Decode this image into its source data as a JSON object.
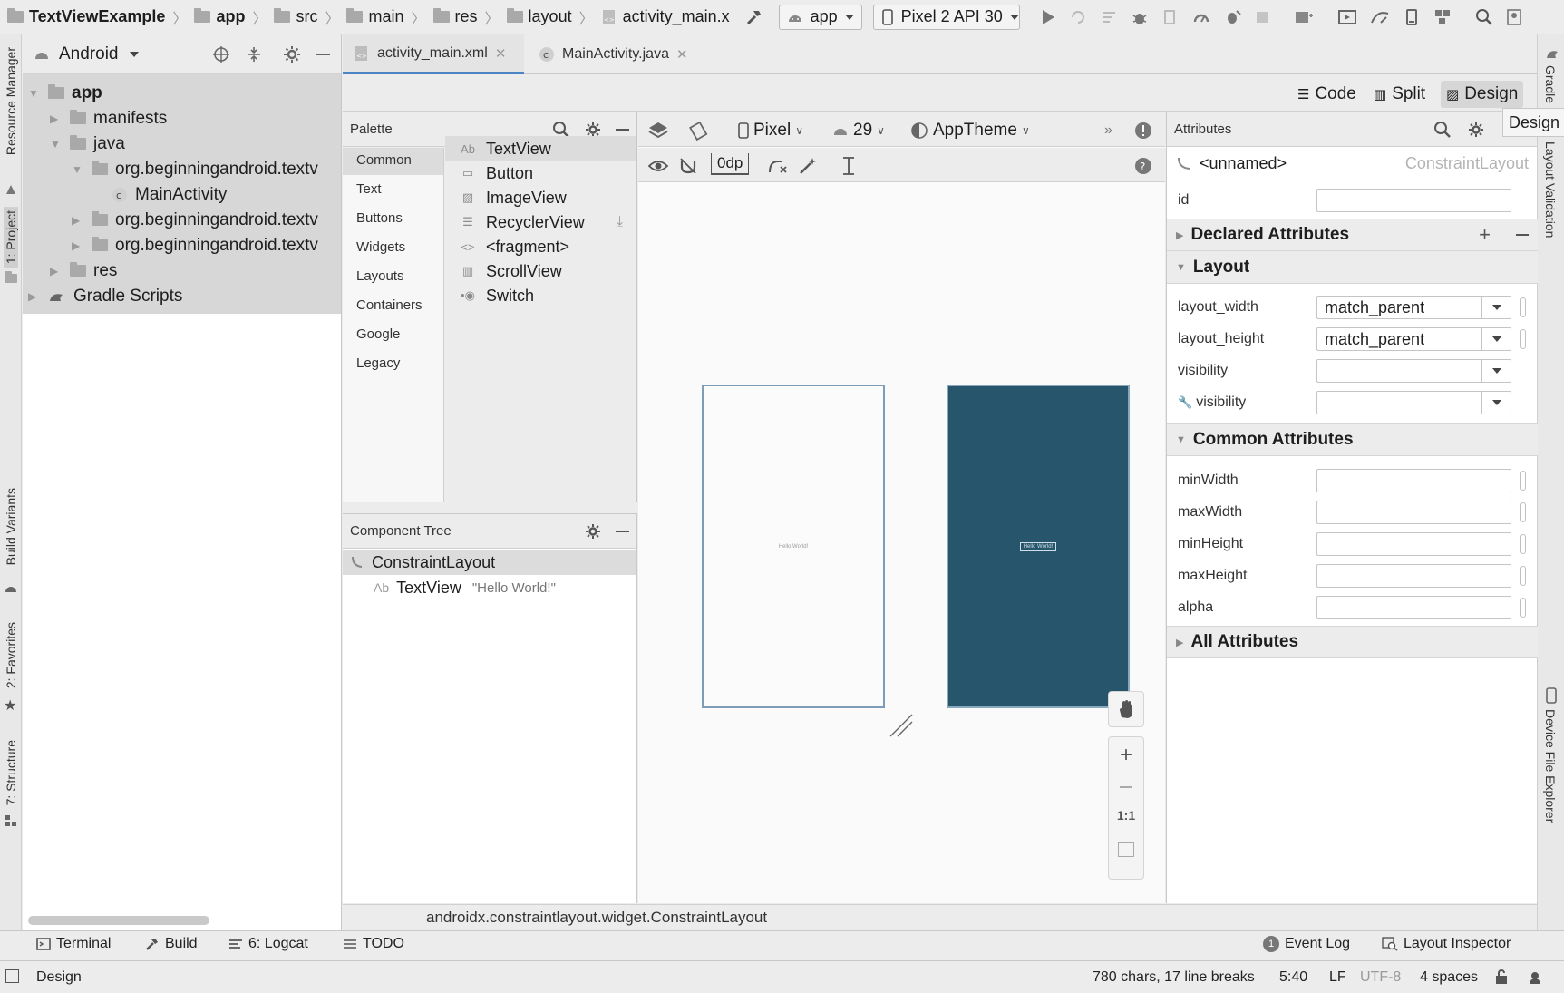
{
  "navbar": {
    "crumbs": [
      "TextViewExample",
      "app",
      "src",
      "main",
      "res",
      "layout",
      "activity_main.x"
    ],
    "run_config": "app",
    "device": "Pixel 2 API 30"
  },
  "left_strip": {
    "resource_manager": "Resource Manager",
    "project": "1: Project",
    "build_variants": "Build Variants",
    "favorites": "2: Favorites",
    "structure": "7: Structure"
  },
  "right_strip": {
    "gradle": "Gradle",
    "layout_validation": "Layout Validation",
    "device_file_explorer": "Device File Explorer"
  },
  "project": {
    "view_selector": "Android",
    "tree": [
      {
        "label": "app",
        "bold": true
      },
      {
        "label": "manifests"
      },
      {
        "label": "java"
      },
      {
        "label": "org.beginningandroid.textv"
      },
      {
        "label": "MainActivity"
      },
      {
        "label": "org.beginningandroid.textv"
      },
      {
        "label": "org.beginningandroid.textv"
      },
      {
        "label": "res"
      },
      {
        "label": "Gradle Scripts"
      }
    ]
  },
  "editor_tabs": [
    {
      "label": "activity_main.xml",
      "active": true
    },
    {
      "label": "MainActivity.java",
      "active": false
    }
  ],
  "modes": {
    "code": "Code",
    "split": "Split",
    "design": "Design",
    "tooltip": "Design"
  },
  "palette": {
    "title": "Palette",
    "categories": [
      "Common",
      "Text",
      "Buttons",
      "Widgets",
      "Layouts",
      "Containers",
      "Google",
      "Legacy"
    ],
    "selected_category": "Common",
    "items": [
      {
        "glyph": "Ab",
        "label": "TextView"
      },
      {
        "glyph": "▭",
        "label": "Button"
      },
      {
        "glyph": "▨",
        "label": "ImageView"
      },
      {
        "glyph": "☰",
        "label": "RecyclerView"
      },
      {
        "glyph": "<>",
        "label": "<fragment>"
      },
      {
        "glyph": "▥",
        "label": "ScrollView"
      },
      {
        "glyph": "•◉",
        "label": "Switch"
      }
    ]
  },
  "component_tree": {
    "title": "Component Tree",
    "root": "ConstraintLayout",
    "child_label": "TextView",
    "child_glyph": "Ab",
    "child_text": "\"Hello World!\""
  },
  "surface": {
    "device": "Pixel",
    "api": "29",
    "theme": "AppTheme",
    "margin": "0dp",
    "preview_text": "Hello World!",
    "blueprint_color": "#27556b",
    "zoom_label": "1:1"
  },
  "attributes": {
    "title": "Attributes",
    "component_name": "<unnamed>",
    "component_type": "ConstraintLayout",
    "id_label": "id",
    "id_value": "",
    "declared_section": "Declared Attributes",
    "layout_section": "Layout",
    "layout_rows": [
      {
        "label": "layout_width",
        "value": "match_parent"
      },
      {
        "label": "layout_height",
        "value": "match_parent"
      },
      {
        "label": "visibility",
        "value": ""
      },
      {
        "label": "visibility",
        "value": ""
      }
    ],
    "common_section": "Common Attributes",
    "common_rows": [
      {
        "label": "minWidth",
        "value": ""
      },
      {
        "label": "maxWidth",
        "value": ""
      },
      {
        "label": "minHeight",
        "value": ""
      },
      {
        "label": "maxHeight",
        "value": ""
      },
      {
        "label": "alpha",
        "value": ""
      }
    ],
    "all_section": "All Attributes"
  },
  "class_status": "androidx.constraintlayout.widget.ConstraintLayout",
  "bottom_tools": {
    "terminal": "Terminal",
    "build": "Build",
    "logcat": "6: Logcat",
    "todo": "TODO",
    "event_log": "Event Log",
    "event_count": "1",
    "layout_inspector": "Layout Inspector"
  },
  "status_bar": {
    "mode": "Design",
    "chars": "780 chars, 17 line breaks",
    "position": "5:40",
    "line_sep": "LF",
    "encoding": "UTF-8",
    "indent": "4 spaces"
  }
}
